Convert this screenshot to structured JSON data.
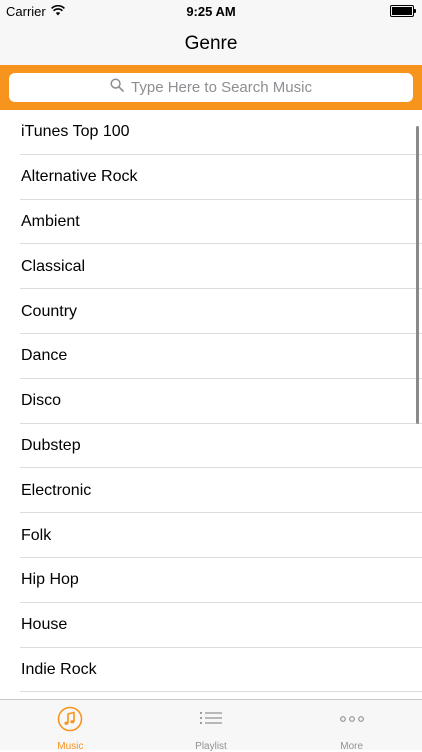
{
  "status_bar": {
    "carrier": "Carrier",
    "time": "9:25 AM"
  },
  "nav": {
    "title": "Genre"
  },
  "search": {
    "placeholder": "Type Here to Search Music"
  },
  "genres": [
    "iTunes Top 100",
    "Alternative Rock",
    "Ambient",
    "Classical",
    "Country",
    "Dance",
    "Disco",
    "Dubstep",
    "Electronic",
    "Folk",
    "Hip Hop",
    "House",
    "Indie Rock"
  ],
  "tabs": [
    {
      "label": "Music",
      "icon": "music-note-icon",
      "active": true
    },
    {
      "label": "Playlist",
      "icon": "list-icon",
      "active": false
    },
    {
      "label": "More",
      "icon": "more-dots-icon",
      "active": false
    }
  ],
  "colors": {
    "accent": "#f7941d",
    "inactive": "#929292",
    "separator": "#dcdcdc"
  }
}
